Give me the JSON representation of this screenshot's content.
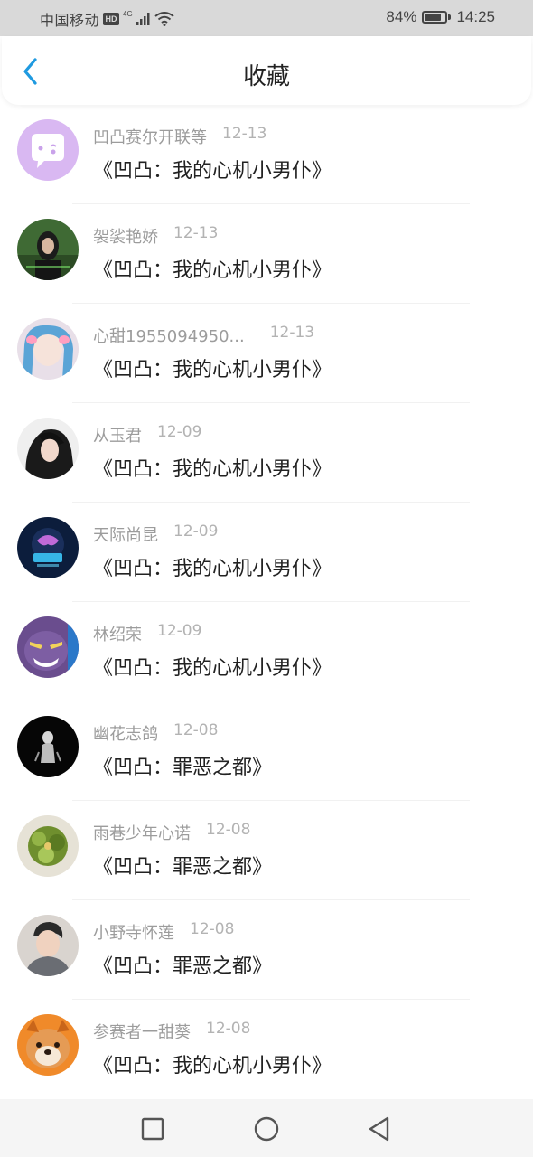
{
  "status_bar": {
    "carrier": "中国移动",
    "hd": "HD",
    "network": "4G",
    "battery": "84%",
    "battery_level": 0.84,
    "time": "14:25",
    "icons": [
      "hd-icon",
      "signal-icon",
      "wifi-icon",
      "battery-icon"
    ]
  },
  "header": {
    "title": "收藏",
    "back_icon": "chevron-left-icon",
    "accent": "#1f9ae0"
  },
  "items": [
    {
      "name": "凹凸赛尔开联等",
      "date": "12-13",
      "title": "《凹凸：我的心机小男仆》"
    },
    {
      "name": "袈裟艳娇",
      "date": "12-13",
      "title": "《凹凸：我的心机小男仆》"
    },
    {
      "name": "心甜1955094950...",
      "date": "12-13",
      "title": "《凹凸：我的心机小男仆》"
    },
    {
      "name": "从玉君",
      "date": "12-09",
      "title": "《凹凸：我的心机小男仆》"
    },
    {
      "name": "天际尚昆",
      "date": "12-09",
      "title": "《凹凸：我的心机小男仆》"
    },
    {
      "name": "林绍荣",
      "date": "12-09",
      "title": "《凹凸：我的心机小男仆》"
    },
    {
      "name": "幽花志鸽",
      "date": "12-08",
      "title": "《凹凸：罪恶之都》"
    },
    {
      "name": "雨巷少年心诺",
      "date": "12-08",
      "title": "《凹凸：罪恶之都》"
    },
    {
      "name": "小野寺怀莲",
      "date": "12-08",
      "title": "《凹凸：罪恶之都》"
    },
    {
      "name": "参赛者一甜葵",
      "date": "12-08",
      "title": "《凹凸：我的心机小男仆》"
    }
  ],
  "nav_bar": {
    "icons": [
      "recent-apps-icon",
      "home-icon",
      "back-icon"
    ]
  }
}
